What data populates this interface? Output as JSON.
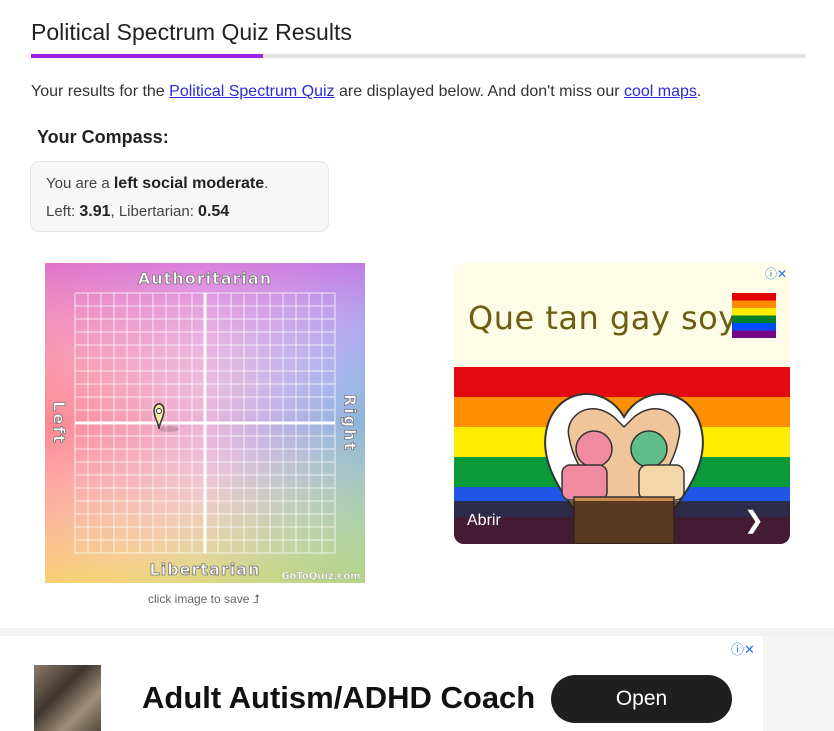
{
  "header": {
    "title": "Political Spectrum Quiz Results"
  },
  "intro": {
    "prefix": "Your results for the ",
    "quiz_link": "Political Spectrum Quiz",
    "middle": " are displayed below. And don't miss our ",
    "maps_link": "cool maps",
    "suffix": "."
  },
  "compass": {
    "heading": "Your Compass:",
    "you_are": "You are a ",
    "label": "left social moderate",
    "period": ".",
    "left_label": "Left: ",
    "left_value": "3.91",
    "sep": ", Libertarian: ",
    "lib_value": "0.54",
    "axis_top": "Authoritarian",
    "axis_bottom": "Libertarian",
    "axis_left": "Left",
    "axis_right": "Right",
    "watermark": "GoToQuiz.com",
    "caption": "click image to save ⮥"
  },
  "ad1": {
    "headline": "Que tan gay soy",
    "cta": "Abrir",
    "chevron": "❯",
    "ad_icons": "ⓘ✕"
  },
  "ad2": {
    "headline": "Adult Autism/ADHD Coach",
    "button": "Open",
    "ad_icons": "ⓘ✕"
  },
  "colors": {
    "accent": "#a11fe0",
    "link": "#2a2ad8"
  },
  "icons": [
    "map-pin-icon",
    "info-icon",
    "close-icon",
    "chevron-right-icon"
  ]
}
